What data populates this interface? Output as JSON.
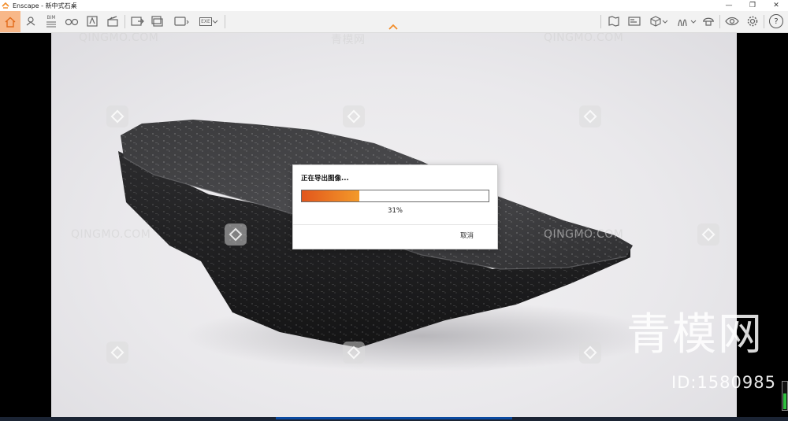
{
  "window": {
    "title": "Enscape - 新中式石桌",
    "minimize_glyph": "—",
    "restore_glyph": "❐",
    "close_glyph": "✕"
  },
  "toolbar": {
    "left_icons": [
      "home-icon",
      "location-pin-icon",
      "bim-icon",
      "binoculars-icon",
      "asset-library-icon",
      "video-editor-icon",
      "screenshot-icon",
      "batch-render-icon",
      "panorama-icon",
      "export-icon"
    ],
    "right_icons": [
      "views-icon",
      "visual-settings-icon",
      "cube-icon",
      "asset-icon",
      "hat-icon",
      "eye-icon",
      "gear-icon",
      "help-icon"
    ],
    "help_label": "?",
    "bim_label": "BIM",
    "export_label": "EXE",
    "accent_color": "#f28c28"
  },
  "dialog": {
    "title": "正在导出图像...",
    "progress_percent": 31,
    "progress_label": "31%",
    "cancel_label": "取消"
  },
  "watermarks": {
    "site_text": "QINGMO.COM",
    "cn_text": "青模网",
    "big_text": "青模网",
    "id_text": "ID:1580985"
  },
  "colors": {
    "progress_start": "#e2561c",
    "progress_end": "#f39a2a",
    "home_highlight": "#f8b889"
  }
}
